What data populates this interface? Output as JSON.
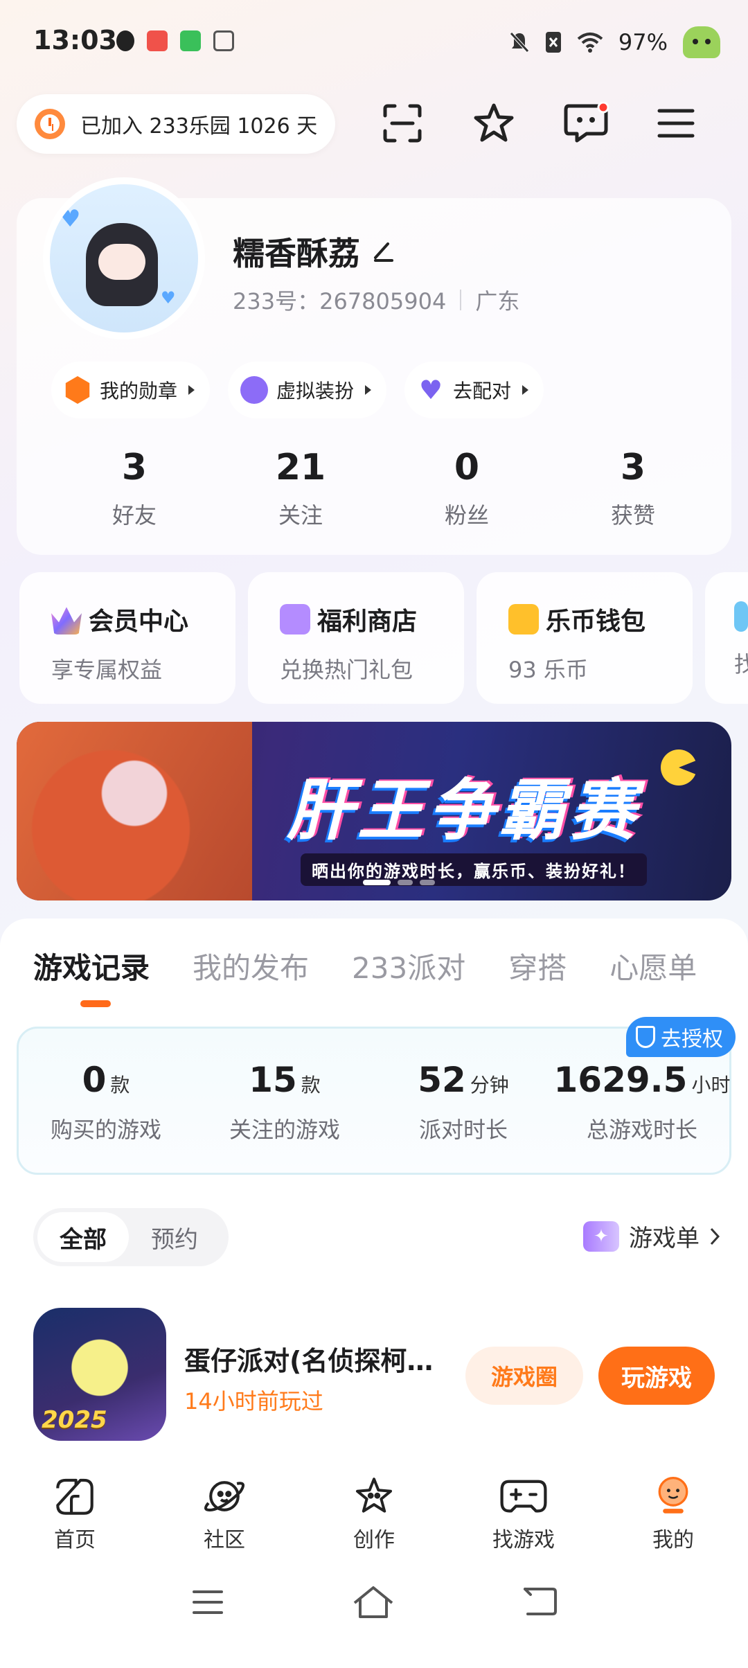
{
  "status_bar": {
    "time": "13:03",
    "battery": "97%",
    "app_icons": [
      "tiktok-icon",
      "app-icon-red",
      "app-icon-green",
      "app-icon-gray"
    ],
    "system_icons": [
      "mute-icon",
      "no-sim-icon",
      "wifi-icon"
    ]
  },
  "top_bar": {
    "joined_text": "已加入 233乐园 1026 天",
    "icons": [
      "scan-icon",
      "star-icon",
      "message-icon",
      "menu-icon"
    ]
  },
  "profile": {
    "name": "糯香酥荔",
    "uid_label": "233号：267805904",
    "region": "广东",
    "chips": [
      {
        "label": "我的勋章",
        "icon": "medal-icon",
        "color": "#ff7a1a"
      },
      {
        "label": "虚拟装扮",
        "icon": "costume-icon",
        "color": "#8c6cf7"
      },
      {
        "label": "去配对",
        "icon": "heart-icon",
        "color": "#7b63f0"
      }
    ],
    "stats": [
      {
        "value": "3",
        "label": "好友"
      },
      {
        "value": "21",
        "label": "关注"
      },
      {
        "value": "0",
        "label": "粉丝"
      },
      {
        "value": "3",
        "label": "获赞"
      }
    ]
  },
  "services": [
    {
      "title": "会员中心",
      "subtitle": "享专属权益",
      "icon": "crown-icon",
      "color": "#8f6cff"
    },
    {
      "title": "福利商店",
      "subtitle": "兑换热门礼包",
      "icon": "gift-icon",
      "color": "#b48cff"
    },
    {
      "title": "乐币钱包",
      "subtitle": "93 乐币",
      "icon": "wallet-icon",
      "color": "#ffc02b"
    },
    {
      "title": "",
      "subtitle": "找",
      "icon": "",
      "color": "#6ec6f5"
    }
  ],
  "banner": {
    "title": "肝王争霸赛",
    "subtitle": "晒出你的游戏时长，赢乐币、装扮好礼！"
  },
  "tabs": [
    "游戏记录",
    "我的发布",
    "233派对",
    "穿搭",
    "心愿单"
  ],
  "game_stats": {
    "auth_badge": "去授权",
    "items": [
      {
        "value": "0",
        "unit": "款",
        "label": "购买的游戏"
      },
      {
        "value": "15",
        "unit": "款",
        "label": "关注的游戏"
      },
      {
        "value": "52",
        "unit": "分钟",
        "label": "派对时长"
      },
      {
        "value": "1629.5",
        "unit": "小时",
        "label": "总游戏时长"
      }
    ]
  },
  "filter": {
    "all": "全部",
    "reserve": "预约",
    "game_list": "游戏单"
  },
  "game": {
    "name": "蛋仔派对(名侦探柯…",
    "last_played": "14小时前玩过",
    "circle_button": "游戏圈",
    "play_button": "玩游戏",
    "thumb_year": "2025"
  },
  "bottom_nav": [
    {
      "label": "首页",
      "icon": "home-icon"
    },
    {
      "label": "社区",
      "icon": "planet-icon"
    },
    {
      "label": "创作",
      "icon": "create-star-icon"
    },
    {
      "label": "找游戏",
      "icon": "gamepad-icon"
    },
    {
      "label": "我的",
      "icon": "profile-icon"
    }
  ],
  "colors": {
    "accent": "#ff6f17",
    "badge_blue": "#2f8ff7"
  }
}
